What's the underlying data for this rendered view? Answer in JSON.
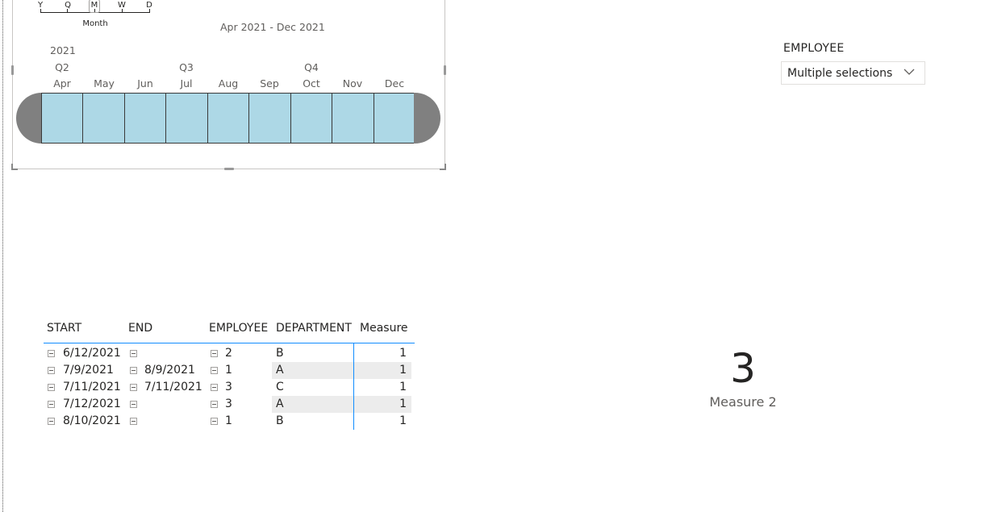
{
  "timeline": {
    "granularity_options": [
      "Y",
      "Q",
      "M",
      "W",
      "D"
    ],
    "granularity_selected": "M",
    "granularity_caption": "Month",
    "range_label": "Apr 2021 - Dec 2021",
    "year": "2021",
    "quarters": [
      "Q2",
      "Q3",
      "Q4"
    ],
    "months": [
      "Apr",
      "May",
      "Jun",
      "Jul",
      "Aug",
      "Sep",
      "Oct",
      "Nov",
      "Dec"
    ],
    "cell_color": "#add8e6",
    "cap_color": "#808080"
  },
  "employee_slicer": {
    "title": "EMPLOYEE",
    "value": "Multiple selections",
    "icon": "chevron-down-icon"
  },
  "table": {
    "headers": [
      "START",
      "END",
      "EMPLOYEE",
      "DEPARTMENT",
      "Measure"
    ],
    "rows": [
      {
        "start": "6/12/2021",
        "end": "",
        "employee": "2",
        "department": "B",
        "measure": "1"
      },
      {
        "start": "7/9/2021",
        "end": "8/9/2021",
        "employee": "1",
        "department": "A",
        "measure": "1"
      },
      {
        "start": "7/11/2021",
        "end": "7/11/2021",
        "employee": "3",
        "department": "C",
        "measure": "1"
      },
      {
        "start": "7/12/2021",
        "end": "",
        "employee": "3",
        "department": "A",
        "measure": "1"
      },
      {
        "start": "8/10/2021",
        "end": "",
        "employee": "1",
        "department": "B",
        "measure": "1"
      }
    ],
    "accent_color": "#118dff"
  },
  "card": {
    "value": "3",
    "label": "Measure 2"
  }
}
